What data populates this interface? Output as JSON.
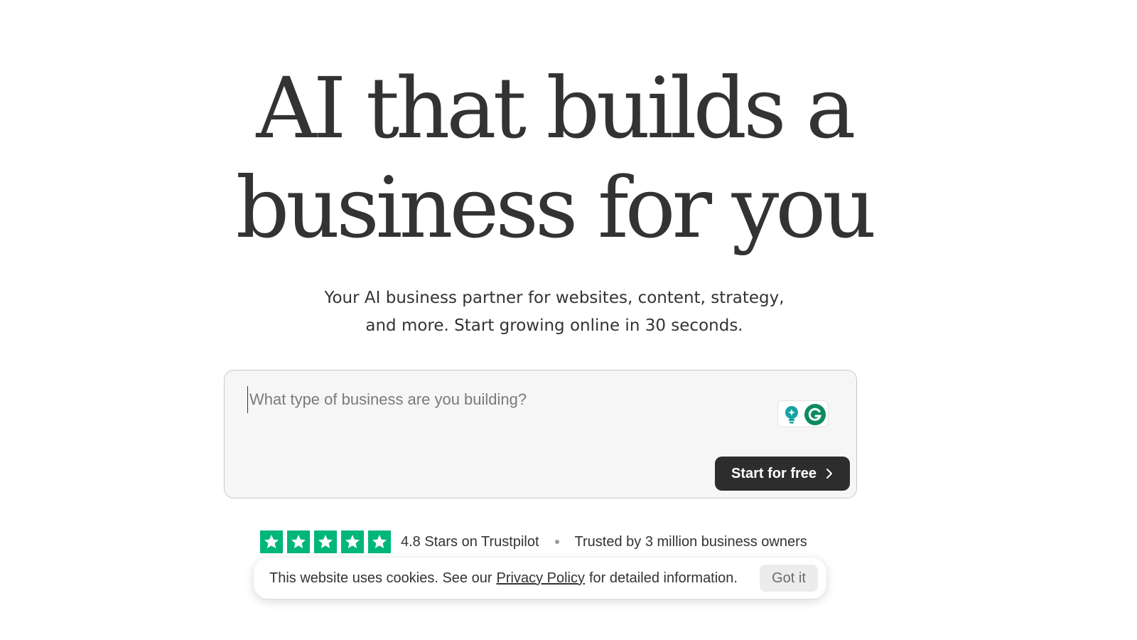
{
  "hero": {
    "headline_line1": "AI that builds a",
    "headline_line2": "business for you",
    "subtitle_line1": "Your AI business partner for websites, content, strategy,",
    "subtitle_line2": "and more. Start growing online in 30 seconds."
  },
  "prompt": {
    "placeholder": "What type of business are you building?",
    "value": "",
    "submit_label": "Start for free"
  },
  "trust": {
    "rating_text": "4.8 Stars on Trustpilot",
    "stars": 5,
    "trusted_text": "Trusted by 3 million business owners",
    "star_color": "#00b67a"
  },
  "cookie_banner": {
    "text_before": "This website uses cookies. See our",
    "link_text": "Privacy Policy",
    "text_after": "for detailed information.",
    "dismiss_label": "Got it"
  },
  "icons": {
    "extension_bulb": "lightbulb-icon",
    "extension_grammarly": "grammarly-icon",
    "button_arrow": "chevron-right-icon",
    "star": "star-icon"
  }
}
